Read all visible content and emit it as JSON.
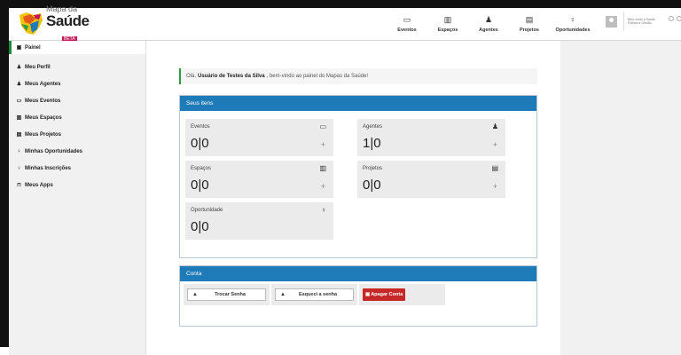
{
  "header": {
    "logo_line1": "Mapa da",
    "logo_line2": "Saúde",
    "beta": "BETA",
    "nav": [
      {
        "label": "Eventos",
        "icon": "calendar-icon"
      },
      {
        "label": "Espaços",
        "icon": "building-icon"
      },
      {
        "label": "Agentes",
        "icon": "user-icon"
      },
      {
        "label": "Projetos",
        "icon": "document-icon"
      },
      {
        "label": "Oportunidades",
        "icon": "lightbulb-icon"
      }
    ],
    "partner_line1": "Bem-vindo à Saúde",
    "partner_line2": "Pública e Gestão"
  },
  "sidebar": {
    "items": [
      {
        "label": "Painel",
        "icon": "dashboard-icon"
      },
      {
        "label": "Meu Perfil",
        "icon": "user-icon"
      },
      {
        "label": "Meus Agentes",
        "icon": "users-icon"
      },
      {
        "label": "Meus Eventos",
        "icon": "calendar-icon"
      },
      {
        "label": "Meus Espaços",
        "icon": "building-icon"
      },
      {
        "label": "Meus Projetos",
        "icon": "document-icon"
      },
      {
        "label": "Minhas Oportunidades",
        "icon": "lightbulb-icon"
      },
      {
        "label": "Minhas Inscrições",
        "icon": "lightbulb-icon"
      },
      {
        "label": "Meus Apps",
        "icon": "box-icon"
      }
    ]
  },
  "welcome": {
    "prefix": "Olá,",
    "user": "Usuário de Testes da Silva",
    "suffix": ", bem-vindo ao painel do Mapas da Saúde!"
  },
  "items_panel": {
    "title": "Seus itens",
    "cards": [
      {
        "label": "Eventos",
        "value": "0|0",
        "icon": "calendar-icon",
        "add": "+"
      },
      {
        "label": "Agentes",
        "value": "1|0",
        "icon": "user-icon",
        "add": "+"
      },
      {
        "label": "Espaços",
        "value": "0|0",
        "icon": "building-icon",
        "add": "+"
      },
      {
        "label": "Projetos",
        "value": "0|0",
        "icon": "document-icon",
        "add": "+"
      },
      {
        "label": "Oportunidade",
        "value": "0|0",
        "icon": "lightbulb-icon"
      }
    ]
  },
  "account_panel": {
    "title": "Conta",
    "change_password": "Trocar Senha",
    "forgot_password": "Esqueci a senha",
    "delete_account": "Apagar Conta"
  }
}
